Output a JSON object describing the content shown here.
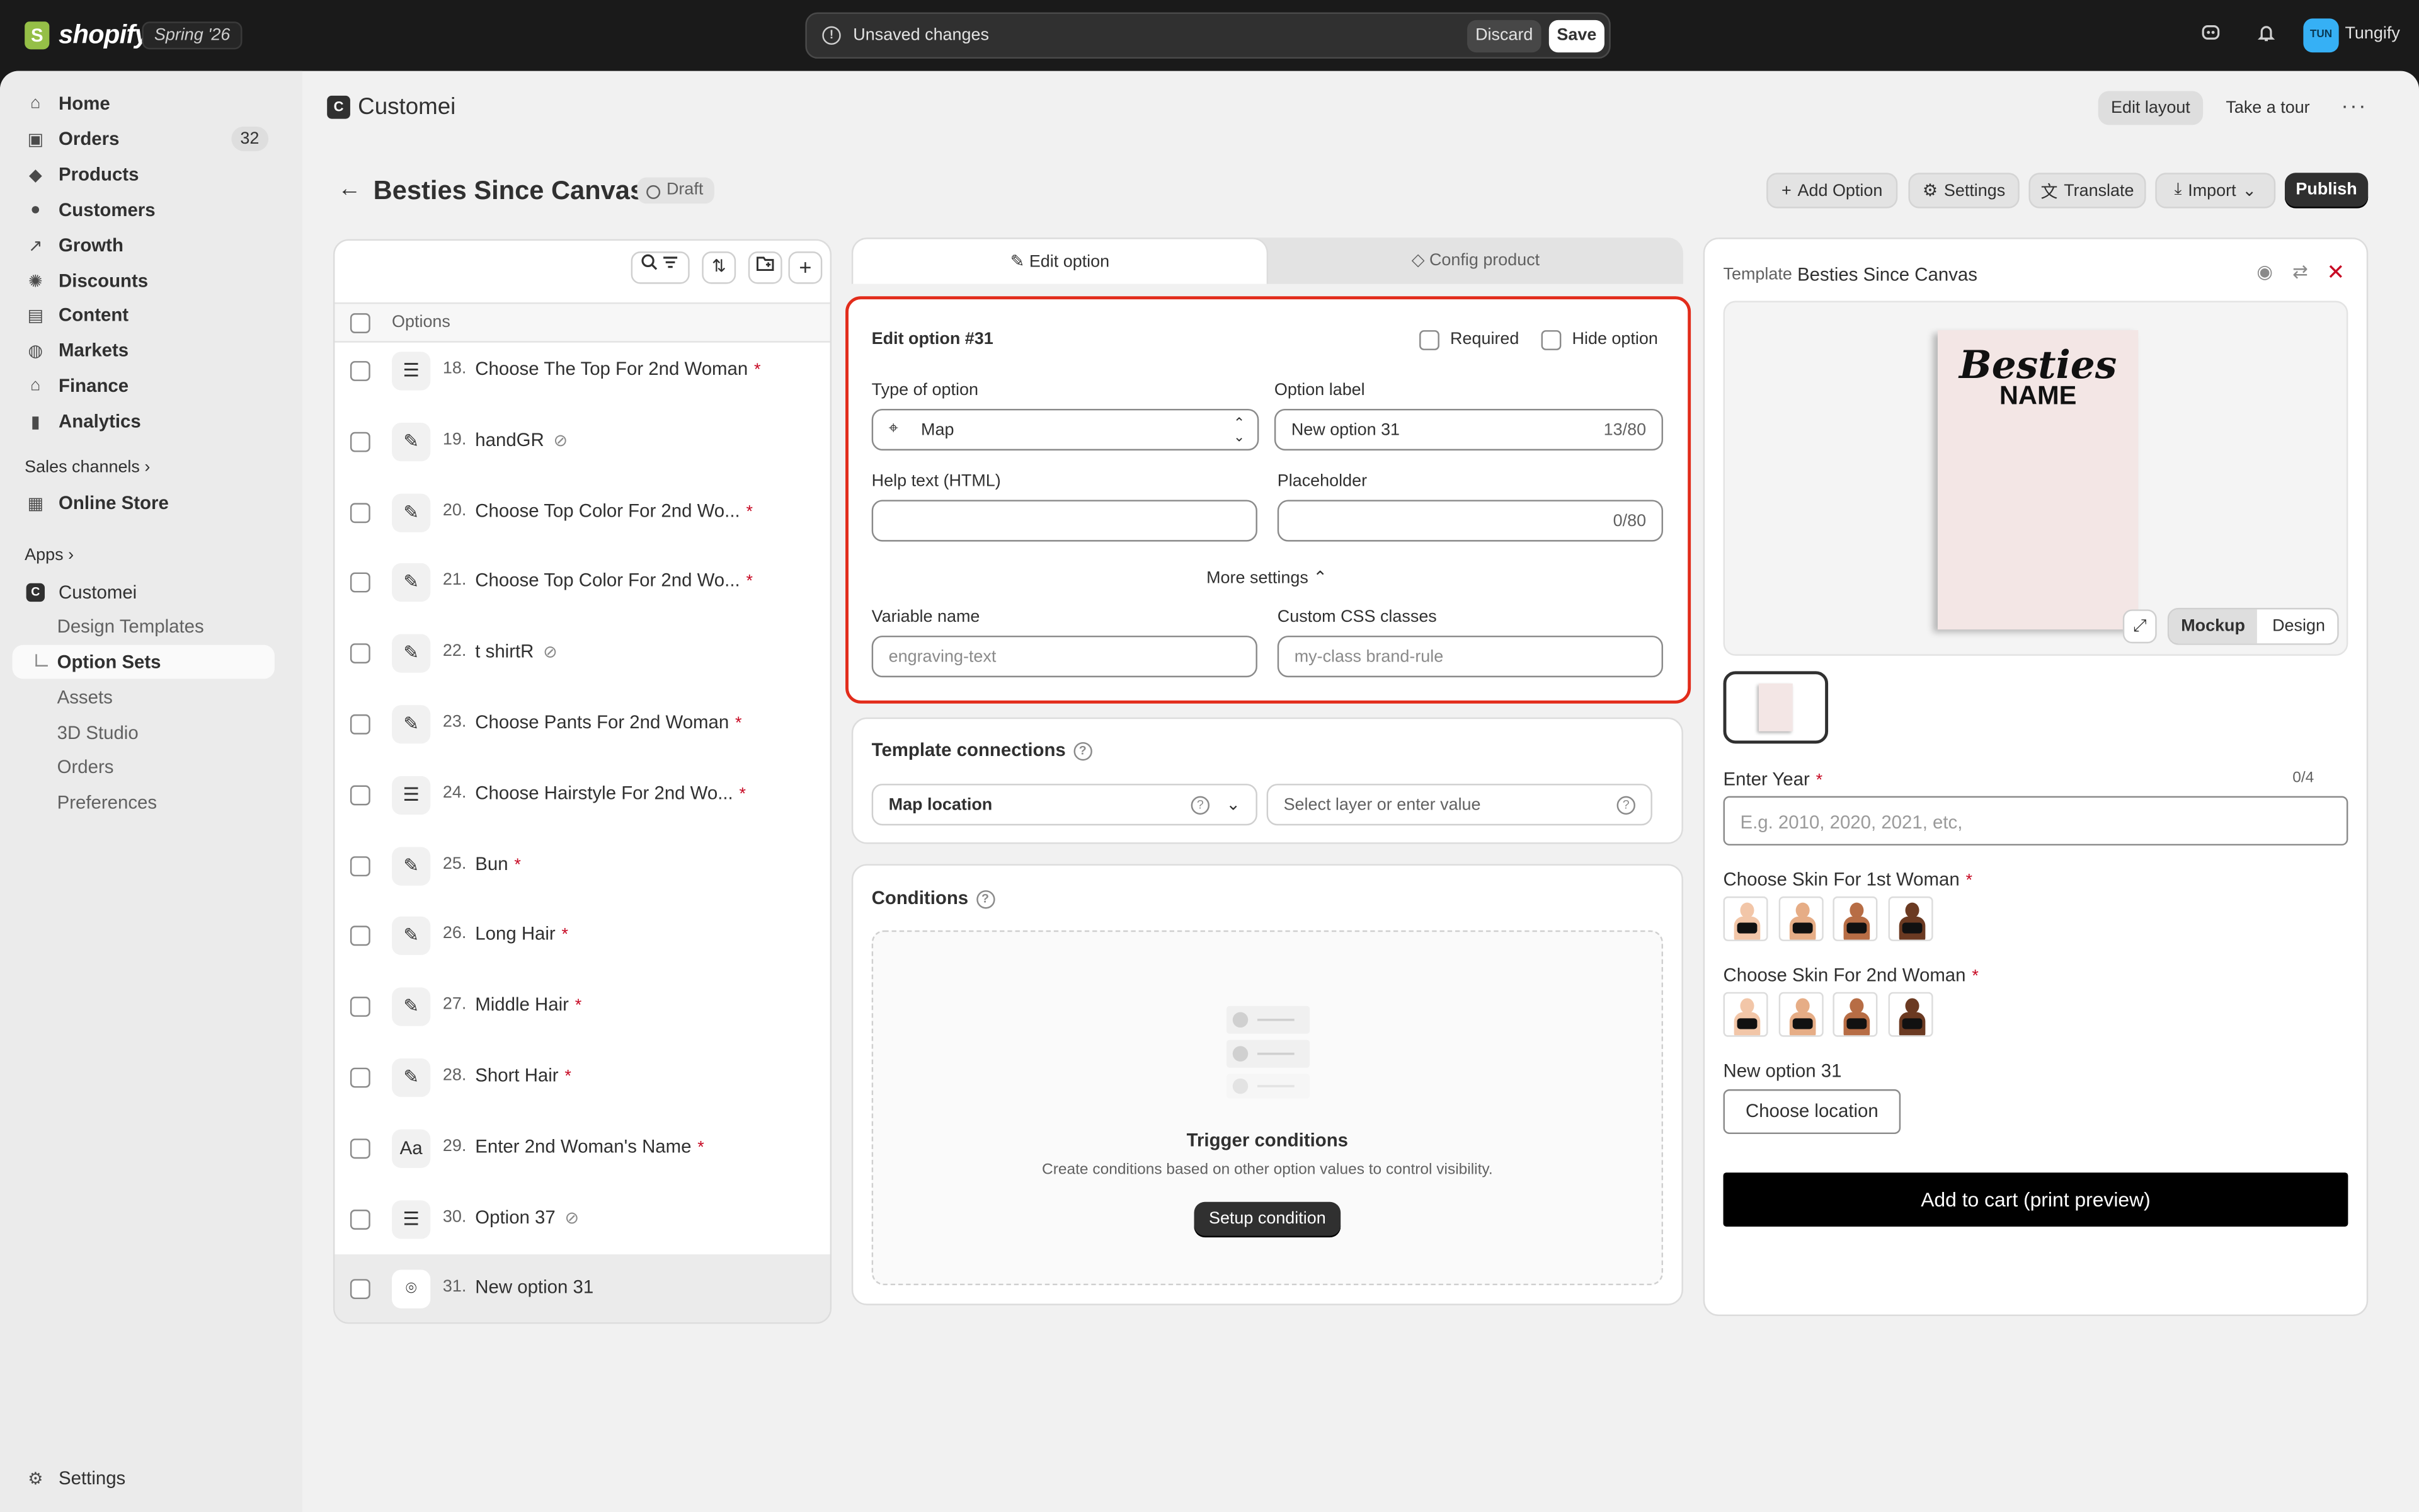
{
  "topbar": {
    "brand": "shopify",
    "version": "Spring '26",
    "unsaved_text": "Unsaved changes",
    "discard_label": "Discard",
    "save_label": "Save",
    "avatar_initials": "TUN",
    "user_name": "Tungify"
  },
  "sidebar": {
    "items": [
      {
        "label": "Home",
        "icon": "home-icon"
      },
      {
        "label": "Orders",
        "icon": "orders-icon",
        "count": "32"
      },
      {
        "label": "Products",
        "icon": "tag-icon"
      },
      {
        "label": "Customers",
        "icon": "person-icon"
      },
      {
        "label": "Growth",
        "icon": "growth-icon"
      },
      {
        "label": "Discounts",
        "icon": "discount-icon"
      },
      {
        "label": "Content",
        "icon": "content-icon"
      },
      {
        "label": "Markets",
        "icon": "globe-icon"
      },
      {
        "label": "Finance",
        "icon": "bank-icon"
      },
      {
        "label": "Analytics",
        "icon": "bar-chart-icon"
      }
    ],
    "sales_channels_label": "Sales channels",
    "online_store_label": "Online Store",
    "apps_label": "Apps",
    "app_name": "Customei",
    "app_badge": "C",
    "app_subitems": [
      "Design Templates",
      "Option Sets",
      "Assets",
      "3D Studio",
      "Orders",
      "Preferences"
    ],
    "active_subitem": "Option Sets",
    "settings_label": "Settings"
  },
  "header": {
    "app_title": "Customei",
    "edit_layout": "Edit layout",
    "take_tour": "Take a tour",
    "more": "···"
  },
  "page": {
    "title": "Besties Since Canvas",
    "status": "Draft",
    "actions": {
      "add_option": "Add Option",
      "settings": "Settings",
      "translate": "Translate",
      "import": "Import",
      "publish": "Publish"
    }
  },
  "options_list": {
    "header": "Options",
    "rows": [
      {
        "num": "18.",
        "label": "Choose The Top For 2nd Woman",
        "required": true,
        "hidden": false,
        "icon": "list-icon"
      },
      {
        "num": "19.",
        "label": "handGR",
        "required": false,
        "hidden": true,
        "icon": "swatch-icon"
      },
      {
        "num": "20.",
        "label": "Choose Top Color For 2nd Wo...",
        "required": true,
        "hidden": false,
        "icon": "swatch-icon"
      },
      {
        "num": "21.",
        "label": "Choose Top Color For 2nd Wo...",
        "required": true,
        "hidden": false,
        "icon": "swatch-icon"
      },
      {
        "num": "22.",
        "label": "t shirtR",
        "required": false,
        "hidden": true,
        "icon": "swatch-icon"
      },
      {
        "num": "23.",
        "label": "Choose Pants For 2nd Woman",
        "required": true,
        "hidden": false,
        "icon": "swatch-icon"
      },
      {
        "num": "24.",
        "label": "Choose Hairstyle For 2nd Wo...",
        "required": true,
        "hidden": false,
        "icon": "list-icon"
      },
      {
        "num": "25.",
        "label": "Bun",
        "required": true,
        "hidden": false,
        "icon": "swatch-icon"
      },
      {
        "num": "26.",
        "label": "Long Hair",
        "required": true,
        "hidden": false,
        "icon": "swatch-icon"
      },
      {
        "num": "27.",
        "label": "Middle Hair",
        "required": true,
        "hidden": false,
        "icon": "swatch-icon"
      },
      {
        "num": "28.",
        "label": "Short Hair",
        "required": true,
        "hidden": false,
        "icon": "swatch-icon"
      },
      {
        "num": "29.",
        "label": "Enter 2nd Woman's Name",
        "required": true,
        "hidden": false,
        "icon": "text-icon"
      },
      {
        "num": "30.",
        "label": "Option 37",
        "required": false,
        "hidden": true,
        "icon": "list-icon"
      },
      {
        "num": "31.",
        "label": "New option 31",
        "required": false,
        "hidden": false,
        "icon": "map-pin-icon",
        "selected": true
      }
    ]
  },
  "tabs": {
    "edit_option": "Edit option",
    "config_product": "Config product"
  },
  "edit_option": {
    "title": "Edit option #31",
    "required_label": "Required",
    "hide_label": "Hide option",
    "type_label": "Type of option",
    "type_value": "Map",
    "option_label_label": "Option label",
    "option_label_value": "New option 31",
    "option_label_count": "13/80",
    "help_text_label": "Help text (HTML)",
    "placeholder_label": "Placeholder",
    "placeholder_count": "0/80",
    "more_settings": "More settings",
    "variable_name_label": "Variable name",
    "variable_name_placeholder": "engraving-text",
    "css_classes_label": "Custom CSS classes",
    "css_classes_placeholder": "my-class brand-rule"
  },
  "connections": {
    "title": "Template connections",
    "select_value": "Map location",
    "layer_placeholder": "Select layer or enter value"
  },
  "conditions": {
    "title": "Conditions",
    "empty_title": "Trigger conditions",
    "empty_desc": "Create conditions based on other option values to control visibility.",
    "setup_button": "Setup condition"
  },
  "preview": {
    "template_label": "Template",
    "template_name": "Besties Since Canvas",
    "canvas_line1": "Besties",
    "canvas_line2": "NAME",
    "mockup_label": "Mockup",
    "design_label": "Design",
    "year_label": "Enter Year",
    "year_count": "0/4",
    "year_placeholder": "E.g. 2010, 2020, 2021, etc,",
    "skin1_label": "Choose Skin For 1st Woman",
    "skin2_label": "Choose Skin For 2nd Woman",
    "skin_tones": [
      "#f2c6a8",
      "#e6ad86",
      "#b76d45",
      "#6b3a22"
    ],
    "new_option_label": "New option 31",
    "choose_location": "Choose location",
    "add_to_cart": "Add to cart (print preview)"
  },
  "colors": {
    "topbar": "#1a1a1a",
    "accent_red": "#e22c1b",
    "required_red": "#c70a24",
    "primary_button": "#303030"
  }
}
